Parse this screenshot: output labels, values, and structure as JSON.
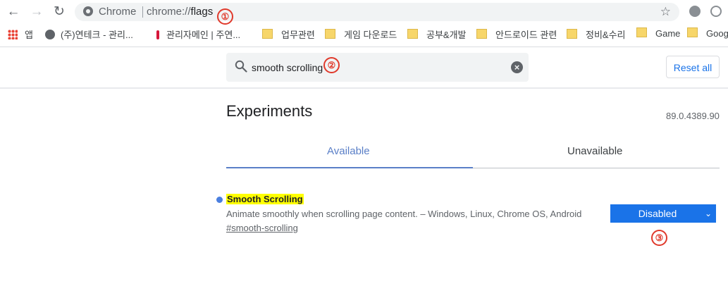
{
  "browser": {
    "omnibox_scheme": "Chrome",
    "omnibox_url_prefix": "chrome://",
    "omnibox_url_path": "flags"
  },
  "bookmarks": [
    {
      "label": "앱",
      "icon": "apps-grid-icon"
    },
    {
      "label": "(주)연테크 - 관리...",
      "icon": "globe-icon"
    },
    {
      "label": "관리자메인 | 주연...",
      "icon": "red-mark-icon"
    },
    {
      "label": "업무관련",
      "icon": "folder-icon"
    },
    {
      "label": "게임 다운로드",
      "icon": "folder-icon"
    },
    {
      "label": "공부&개발",
      "icon": "folder-icon"
    },
    {
      "label": "안드로이드 관련",
      "icon": "folder-icon"
    },
    {
      "label": "정비&수리",
      "icon": "folder-icon"
    },
    {
      "label": "Game",
      "icon": "folder-icon"
    },
    {
      "label": "Google",
      "icon": "folder-icon"
    }
  ],
  "search": {
    "value": "smooth scrolling"
  },
  "header": {
    "reset_label": "Reset all",
    "title": "Experiments",
    "version": "89.0.4389.90"
  },
  "tabs": {
    "available": "Available",
    "unavailable": "Unavailable"
  },
  "flag": {
    "name": "Smooth Scrolling",
    "description": "Animate smoothly when scrolling page content. – Windows, Linux, Chrome OS, Android",
    "link": "#smooth-scrolling",
    "state": "Disabled"
  },
  "annotations": [
    "①",
    "②",
    "③"
  ],
  "colors": {
    "accent": "#1a73e8",
    "highlight": "#ffff00",
    "annotation": "#e0392b"
  }
}
